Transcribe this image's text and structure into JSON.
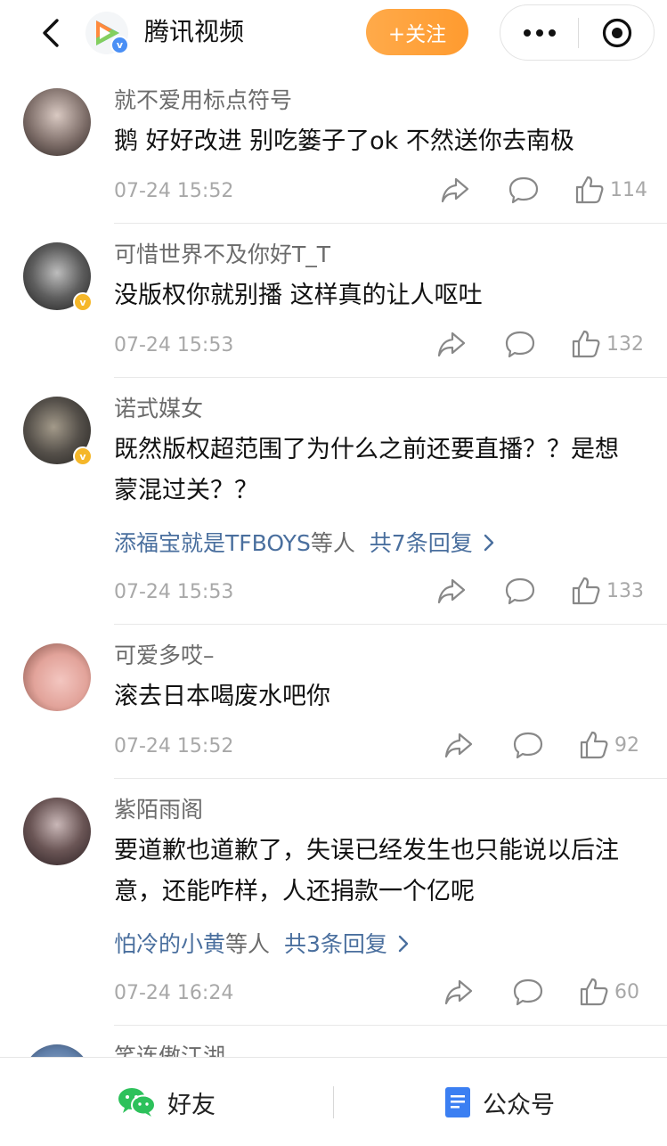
{
  "header": {
    "app_title": "腾讯视频",
    "verified_mark": "v",
    "follow_label": "+关注"
  },
  "comments": [
    {
      "nickname": "就不爱用标点符号",
      "text": "鹅 好好改进 别吃篓子了ok 不然送你去南极",
      "time": "07-24 15:52",
      "likes": "114",
      "badge": ""
    },
    {
      "nickname": "可惜世界不及你好T_T",
      "text": "没版权你就别播 这样真的让人呕吐",
      "time": "07-24 15:53",
      "likes": "132",
      "badge": "v"
    },
    {
      "nickname": "诺式媒女",
      "text": "既然版权超范围了为什么之前还要直播？？是想蒙混过关？？",
      "reply_names": "添福宝就是TFBOYS",
      "reply_mid": "等人",
      "reply_count": "共7条回复",
      "time": "07-24 15:53",
      "likes": "133",
      "badge": "v"
    },
    {
      "nickname": "可爱多哎–",
      "text": "滚去日本喝废水吧你",
      "time": "07-24 15:52",
      "likes": "92",
      "badge": ""
    },
    {
      "nickname": "紫陌雨阁",
      "text": "要道歉也道歉了，失误已经发生也只能说以后注意，还能咋样，人还捐款一个亿呢",
      "reply_names": "怕冷的小黄",
      "reply_mid": "等人",
      "reply_count": "共3条回复",
      "time": "07-24 16:24",
      "likes": "60",
      "badge": ""
    },
    {
      "nickname": "笑连傲江湖"
    }
  ],
  "bottom_bar": {
    "friends_label": "好友",
    "official_label": "公众号"
  },
  "colors": {
    "follow_button": "#ff9b2f",
    "reply_link": "#4a6f9e",
    "verified_badge": "#f5b72a",
    "wechat_green": "#2dc15b",
    "official_blue": "#3b7ff2"
  },
  "icons": [
    "back-arrow-icon",
    "tencent-video-logo-icon",
    "more-dots-icon",
    "target-close-icon",
    "share-icon",
    "comment-icon",
    "like-icon",
    "wechat-icon",
    "document-icon"
  ]
}
